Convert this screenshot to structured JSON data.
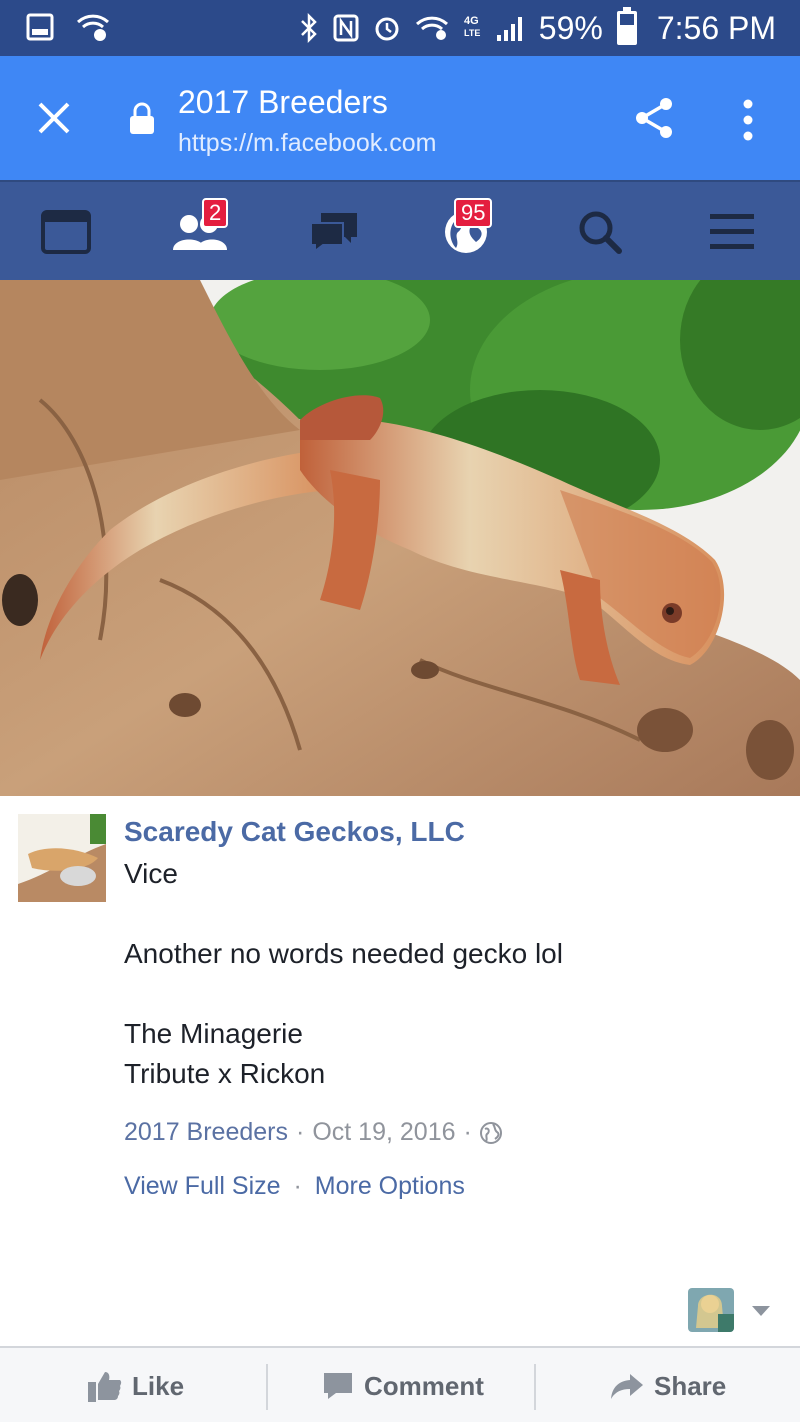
{
  "status_bar": {
    "battery": "59%",
    "time": "7:56 PM",
    "network": "4G LTE",
    "icons": [
      "image-icon",
      "wifi-question-icon",
      "bluetooth-icon",
      "nfc-icon",
      "alarm-icon",
      "wifi-icon",
      "signal-icon",
      "battery-icon"
    ]
  },
  "browser": {
    "title": "2017 Breeders",
    "url": "https://m.facebook.com",
    "close_icon": "close-icon",
    "lock_icon": "lock-icon",
    "share_icon": "share-icon",
    "menu_icon": "more-vert-icon"
  },
  "fb_nav": {
    "friend_requests_badge": "2",
    "notifications_badge": "95",
    "colors": {
      "bar": "#3b5998",
      "badge": "#e41e3f"
    }
  },
  "post": {
    "author": "Scaredy Cat Geckos, LLC",
    "lines": [
      "Vice",
      "Another no words needed gecko lol",
      "The Minagerie",
      "Tribute x Rickon"
    ],
    "album": "2017 Breeders",
    "date": "Oct 19, 2016",
    "sep": "·",
    "view_full_size": "View Full Size",
    "more_options": "More Options"
  },
  "actions": {
    "like": "Like",
    "comment": "Comment",
    "share": "Share"
  }
}
